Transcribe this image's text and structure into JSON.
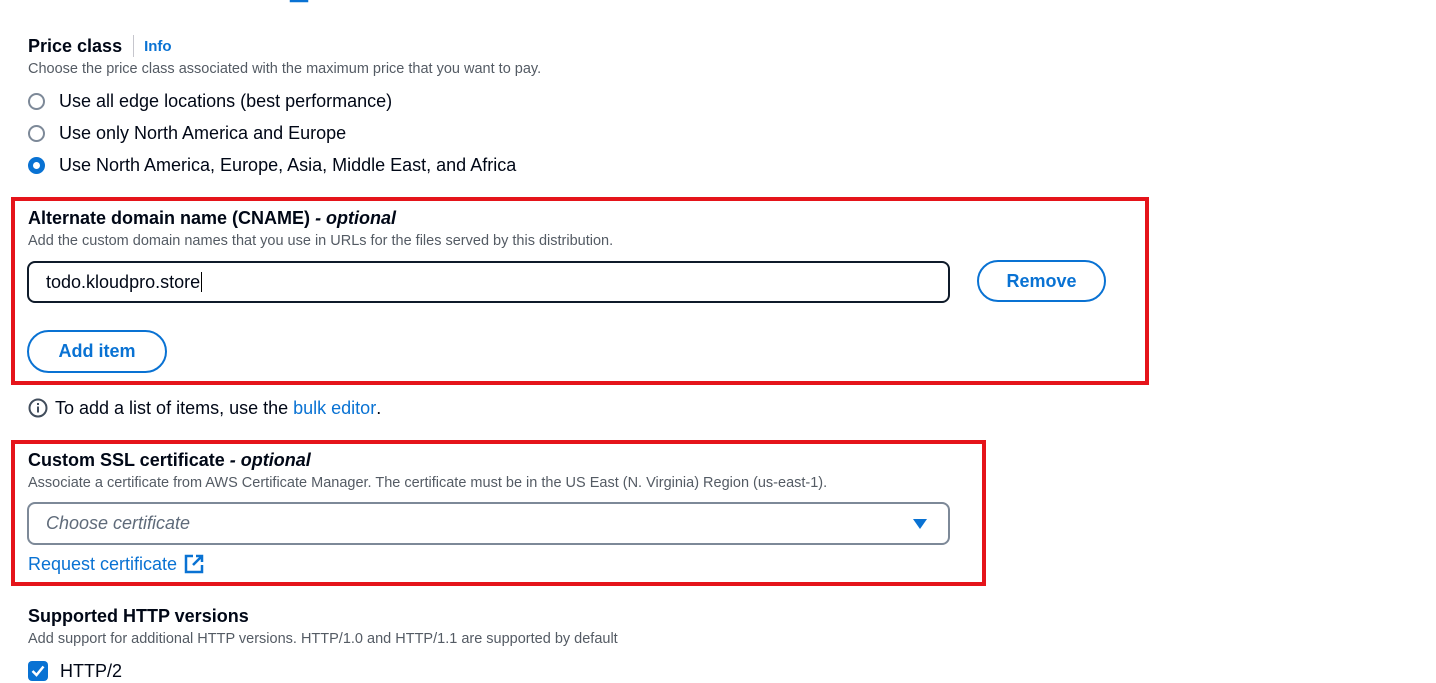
{
  "price_class": {
    "title": "Price class",
    "info": "Info",
    "description": "Choose the price class associated with the maximum price that you want to pay.",
    "options": [
      {
        "label": "Use all edge locations (best performance)",
        "selected": false
      },
      {
        "label": "Use only North America and Europe",
        "selected": false
      },
      {
        "label": "Use North America, Europe, Asia, Middle East, and Africa",
        "selected": true
      }
    ]
  },
  "cname": {
    "title": "Alternate domain name (CNAME)",
    "optional": "- optional",
    "description": "Add the custom domain names that you use in URLs for the files served by this distribution.",
    "value": "todo.kloudpro.store",
    "remove_label": "Remove",
    "add_label": "Add item"
  },
  "bulk_hint": {
    "text": "To add a list of items, use the",
    "link": "bulk editor",
    "end": "."
  },
  "ssl": {
    "title": "Custom SSL certificate",
    "optional": "- optional",
    "description": "Associate a certificate from AWS Certificate Manager. The certificate must be in the US East (N. Virginia) Region (us-east-1).",
    "placeholder": "Choose certificate",
    "request_link": "Request certificate"
  },
  "http": {
    "title": "Supported HTTP versions",
    "description": "Add support for additional HTTP versions. HTTP/1.0 and HTTP/1.1 are supported by default",
    "options": [
      {
        "label": "HTTP/2",
        "checked": true
      }
    ]
  },
  "colors": {
    "accent": "#0972d3",
    "highlight_border": "#e5141a",
    "text": "#000716",
    "muted": "#545b64"
  }
}
